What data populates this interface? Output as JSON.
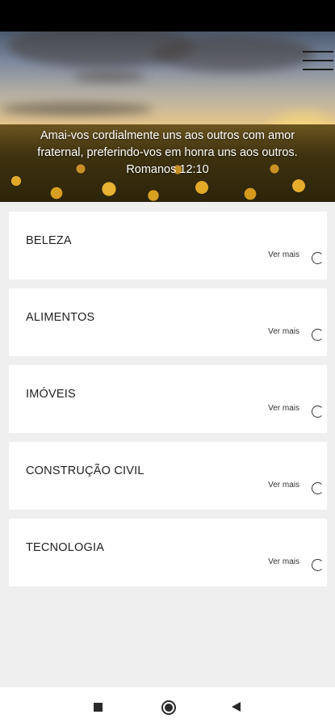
{
  "header": {
    "menu_icon": "hamburger-menu-icon",
    "verse_lines": [
      "Amai-vos cordialmente uns aos outros com amor",
      "fraternal, preferindo-vos em honra uns aos outros.",
      "Romanos 12:10"
    ]
  },
  "categories": [
    {
      "title": "BELEZA",
      "more": "Ver mais"
    },
    {
      "title": "ALIMENTOS",
      "more": "Ver mais"
    },
    {
      "title": "IMÓVEIS",
      "more": "Ver mais"
    },
    {
      "title": "CONSTRUÇÃO CIVIL",
      "more": "Ver mais"
    },
    {
      "title": "TECNOLOGIA",
      "more": "Ver mais"
    }
  ],
  "nav_bar": {
    "recents_icon": "square-icon",
    "home_icon": "circle-icon",
    "back_icon": "back-triangle-icon"
  }
}
